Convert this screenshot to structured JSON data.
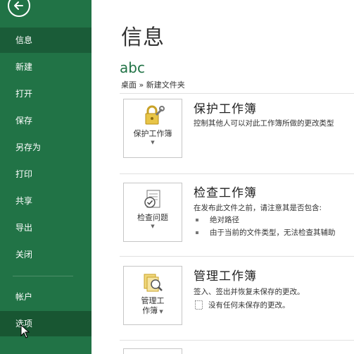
{
  "sidebar": {
    "back_icon": "back-arrow-icon",
    "items": [
      {
        "label": "信息",
        "state": "active"
      },
      {
        "label": "新建"
      },
      {
        "label": "打开"
      },
      {
        "label": "保存"
      },
      {
        "label": "另存为"
      },
      {
        "label": "打印"
      },
      {
        "label": "共享"
      },
      {
        "label": "导出"
      },
      {
        "label": "关闭"
      },
      {
        "label": "帐户"
      },
      {
        "label": "选项",
        "state": "hover"
      }
    ],
    "bg_color": "#217346"
  },
  "main": {
    "title": "信息",
    "file_name": "abc",
    "breadcrumb": "桌面 » 新建文件夹",
    "sections": [
      {
        "button_label": "保护工作簿",
        "button_icon": "lock-key-icon",
        "title": "保护工作簿",
        "description": "控制其他人可以对此工作簿所做的更改类型"
      },
      {
        "button_label": "检查问题",
        "button_icon": "inspect-document-icon",
        "title": "检查工作簿",
        "description": "在发布此文件之前，请注意其是否包含:",
        "bullets": [
          "绝对路径",
          "由于当前的文件类型，无法检查其辅助"
        ]
      },
      {
        "button_label_line1": "管理工",
        "button_label_line2": "作簿",
        "button_icon": "manage-workbook-icon",
        "title": "管理工作簿",
        "description": "签入、签出并恢复未保存的更改。",
        "doc_note": "没有任何未保存的更改。"
      }
    ]
  }
}
